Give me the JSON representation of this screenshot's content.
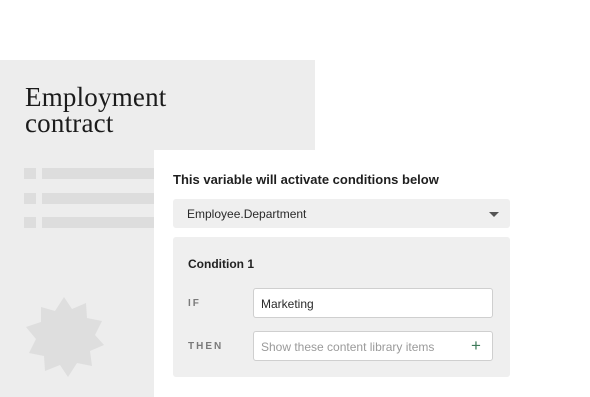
{
  "document": {
    "title_line1": "Employment",
    "title_line2": "contract"
  },
  "panel": {
    "heading": "This variable will activate conditions below",
    "variable_select": {
      "value": "Employee.Department",
      "icon": "chevron-down-icon"
    },
    "condition": {
      "title": "Condition 1",
      "if_label": "IF",
      "if_value": "Marketing",
      "then_label": "THEN",
      "then_placeholder": "Show these content library items",
      "add_icon": "plus-icon",
      "add_symbol": "+"
    }
  },
  "colors": {
    "document_bg": "#ededed",
    "condition_bg": "#efefef",
    "accent_green": "#3f7a5a"
  }
}
